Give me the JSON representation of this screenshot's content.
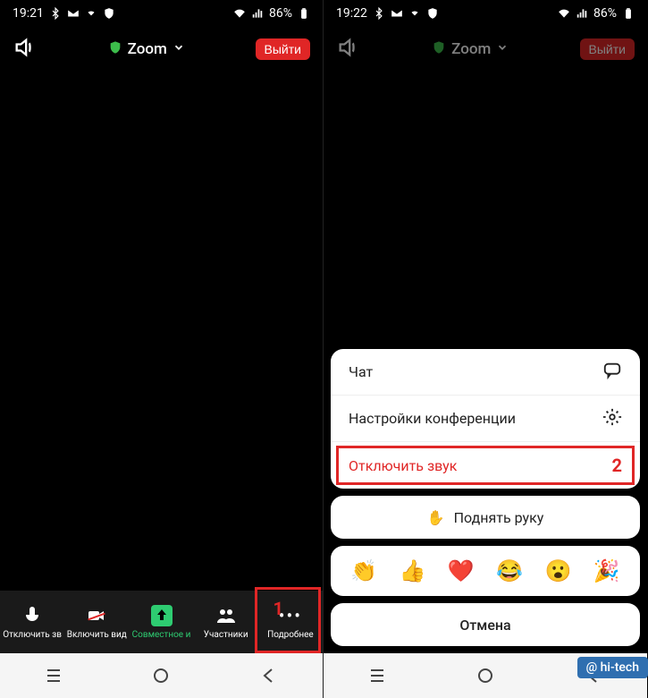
{
  "statusbar": {
    "time_left": "19:21",
    "time_right": "19:22",
    "battery": "86%"
  },
  "topbar": {
    "title": "Zoom",
    "exit_label": "Выйти"
  },
  "bottombar": {
    "items": [
      {
        "label": "Отключить зв"
      },
      {
        "label": "Включить вид"
      },
      {
        "label": "Совместное и"
      },
      {
        "label": "Участники"
      },
      {
        "label": "Подробнее"
      }
    ]
  },
  "annotation": {
    "num1": "1",
    "num2": "2"
  },
  "sheet": {
    "menu": [
      {
        "label": "Чат",
        "icon": "chat-icon"
      },
      {
        "label": "Настройки конференции",
        "icon": "gear-icon"
      },
      {
        "label": "Отключить звук",
        "danger": true
      }
    ],
    "raise_hand": "Поднять руку",
    "emojis": [
      "👏",
      "👍",
      "❤️",
      "😂",
      "😮",
      "🎉"
    ],
    "cancel": "Отмена"
  },
  "watermark": "@ hi‑tech"
}
